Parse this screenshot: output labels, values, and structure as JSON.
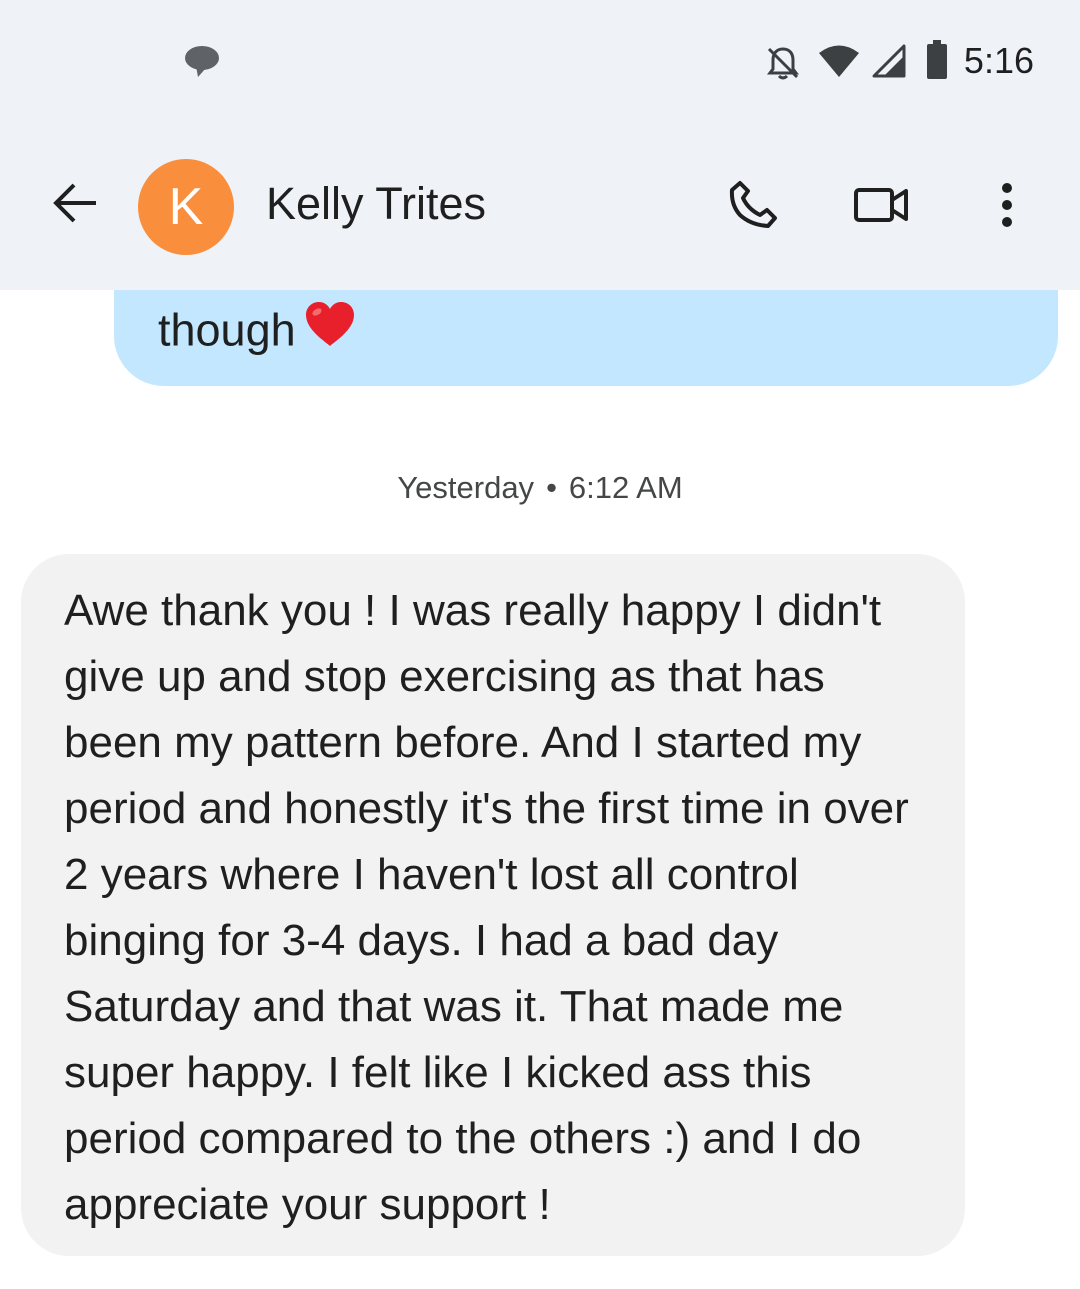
{
  "status_bar": {
    "time": "5:16",
    "icons": [
      "chat-notification-icon",
      "notifications-off-icon",
      "wifi-icon",
      "cell-signal-icon",
      "battery-icon"
    ]
  },
  "app_bar": {
    "back_icon": "arrow-back-icon",
    "avatar_letter": "K",
    "avatar_color": "#f98e3d",
    "contact_name": "Kelly Trites",
    "actions": [
      "phone-icon",
      "video-call-icon",
      "more-vert-icon"
    ]
  },
  "conversation": {
    "sent_partial": {
      "text": "though",
      "emoji": "red-heart",
      "color": "#c3e7ff"
    },
    "timestamp": {
      "day": "Yesterday",
      "time": "6:12 AM"
    },
    "received": {
      "text": "Awe thank you ! I was really happy I didn't\ngive up and stop exercising as that has\nbeen my pattern before. And I started my\nperiod and honestly it's the first time in over\n2 years where I haven't lost all control\nbinging for 3-4 days. I had a bad day\nSaturday and that was it. That made me\nsuper happy. I felt like I kicked ass this\nperiod compared to the others :) and I do\nappreciate your support !",
      "color": "#f2f2f2"
    }
  }
}
